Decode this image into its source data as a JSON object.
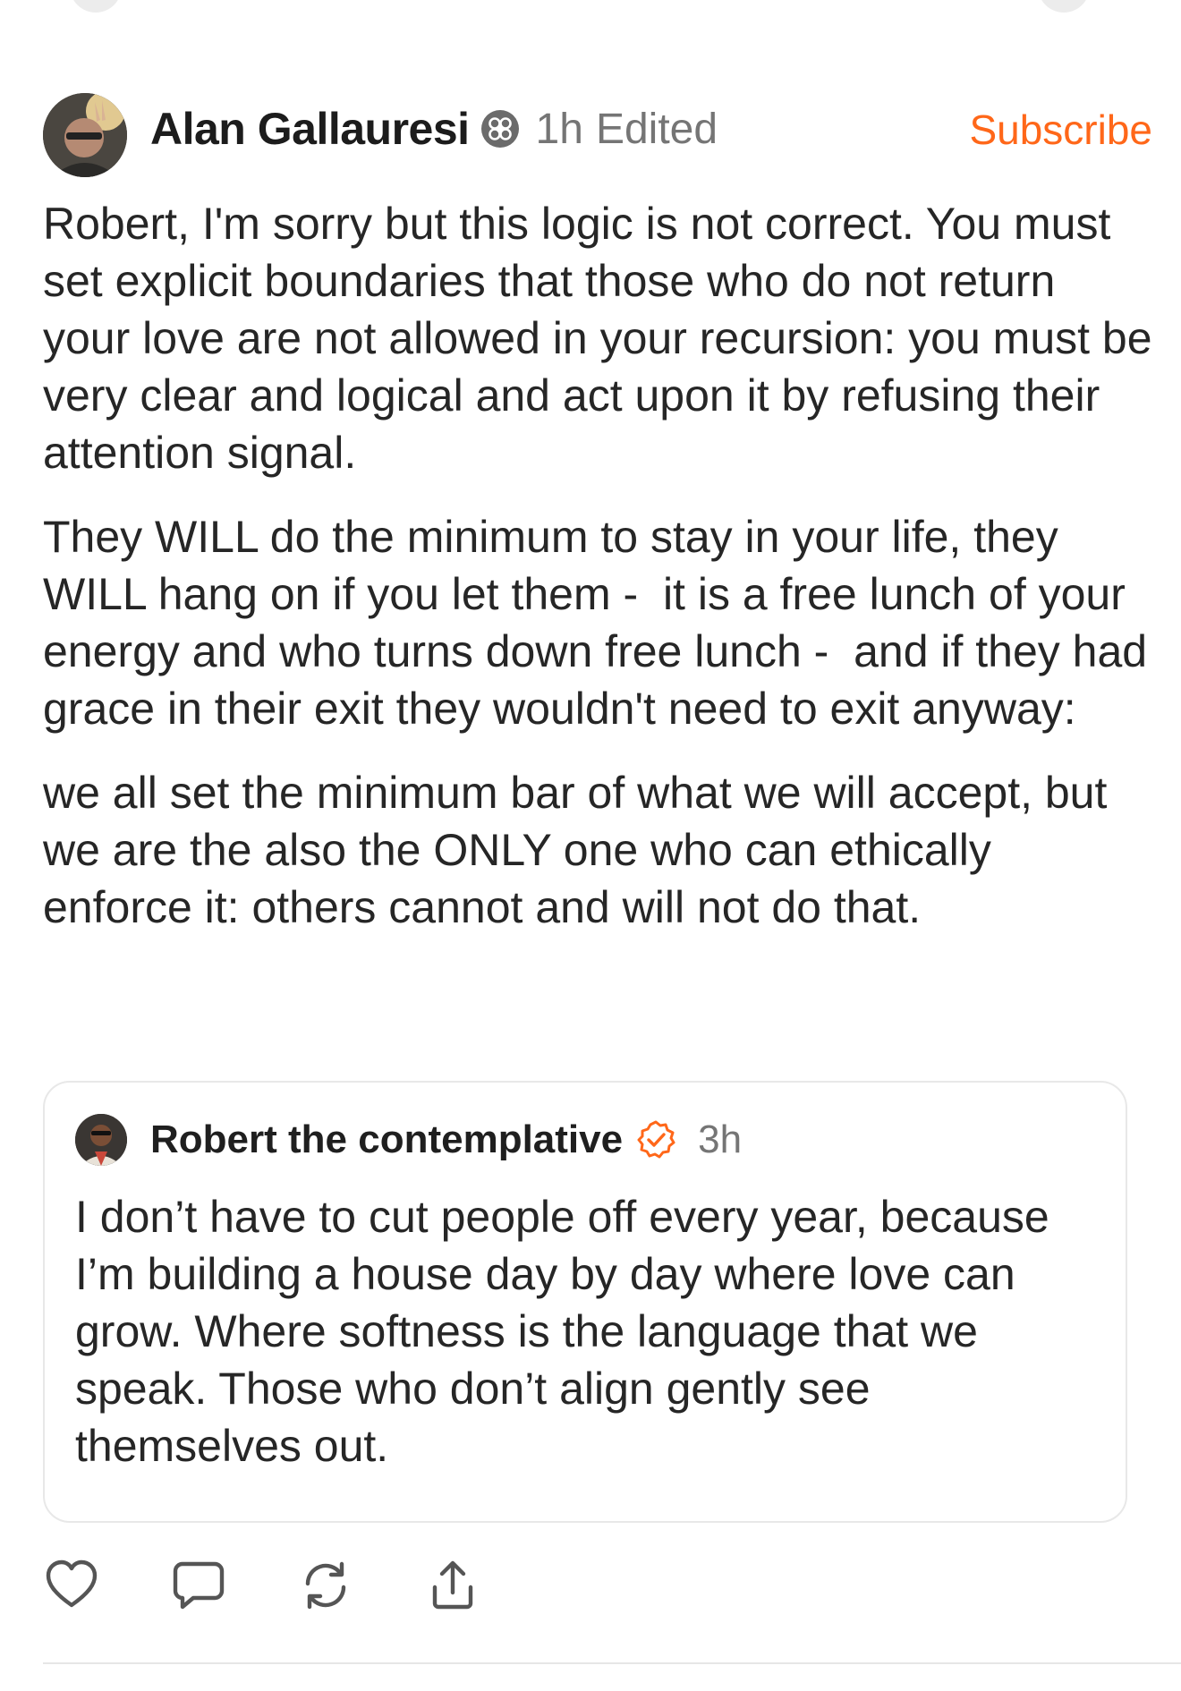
{
  "colors": {
    "accent": "#ff6719",
    "meta": "#757575",
    "text": "#262626"
  },
  "post": {
    "author": "Alan Gallauresi",
    "author_badge_icon": "subscriber-badge-icon",
    "time": "1h",
    "edited_label": "Edited",
    "subscribe_label": "Subscribe",
    "paragraphs": [
      "Robert, I'm sorry but this logic is not correct. You must set explicit boundaries that those who do not return your love are not allowed in your recursion: you must be very clear and logical and act upon it by refusing their attention signal.",
      "They WILL do the minimum to stay in your life, they WILL hang on if you let them -  it is a free lunch of your energy and who turns down free lunch -  and if they had grace in their exit they wouldn't need to exit anyway:",
      "we all set the minimum bar of what we will accept, but we are the also the ONLY one who can ethically enforce it: others cannot and will not do that."
    ]
  },
  "quote": {
    "author": "Robert the contemplative",
    "verified_icon": "verified-check-icon",
    "time": "3h",
    "text": "I don’t have to cut people off every year, because I’m building a house day by day where love can grow. Where softness is the language that we speak. Those who don’t align gently see themselves out."
  },
  "actions": [
    {
      "name": "like-button",
      "icon": "heart-icon"
    },
    {
      "name": "reply-button",
      "icon": "comment-icon"
    },
    {
      "name": "restack-button",
      "icon": "restack-icon"
    },
    {
      "name": "share-button",
      "icon": "share-icon"
    }
  ]
}
